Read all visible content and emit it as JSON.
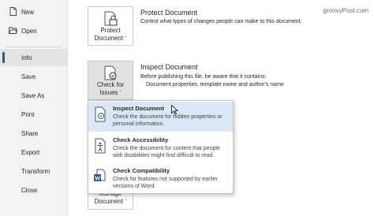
{
  "sidebar": {
    "items": [
      {
        "label": "New",
        "icon": "new-document-icon"
      },
      {
        "label": "Open",
        "icon": "folder-open-icon"
      },
      {
        "label": "Info",
        "active": true
      },
      {
        "label": "Save"
      },
      {
        "label": "Save As"
      },
      {
        "label": "Print"
      },
      {
        "label": "Share"
      },
      {
        "label": "Export"
      },
      {
        "label": "Transform"
      },
      {
        "label": "Close"
      }
    ]
  },
  "protect": {
    "button_line1": "Protect",
    "button_line2": "Document",
    "caret": "ˇ",
    "title": "Protect Document",
    "desc": "Control what types of changes people can make to this document."
  },
  "inspect": {
    "button_line1": "Check for",
    "button_line2": "Issues",
    "caret": "ˇ",
    "title": "Inspect Document",
    "desc1": "Before publishing this file, be aware that it contains:",
    "desc2": "Document properties, template name and author's name"
  },
  "manage": {
    "button_line1": "Manage",
    "button_line2": "Document",
    "caret": "ˇ"
  },
  "dropdown": {
    "items": [
      {
        "title": "Inspect Document",
        "desc": "Check the document for hidden properties or personal information.",
        "icon": "inspect-icon"
      },
      {
        "title": "Check Accessibility",
        "desc": "Check the document for content that people with disabilities might find difficult to read.",
        "icon": "accessibility-icon"
      },
      {
        "title": "Check Compatibility",
        "desc": "Check for features not supported by earlier versions of Word.",
        "icon": "compatibility-icon"
      }
    ]
  },
  "watermark": "groovyPost.com",
  "colors": {
    "accent": "#2b579a",
    "hover": "#d9e7f6",
    "sidebar_bg": "#f3f3f3"
  }
}
